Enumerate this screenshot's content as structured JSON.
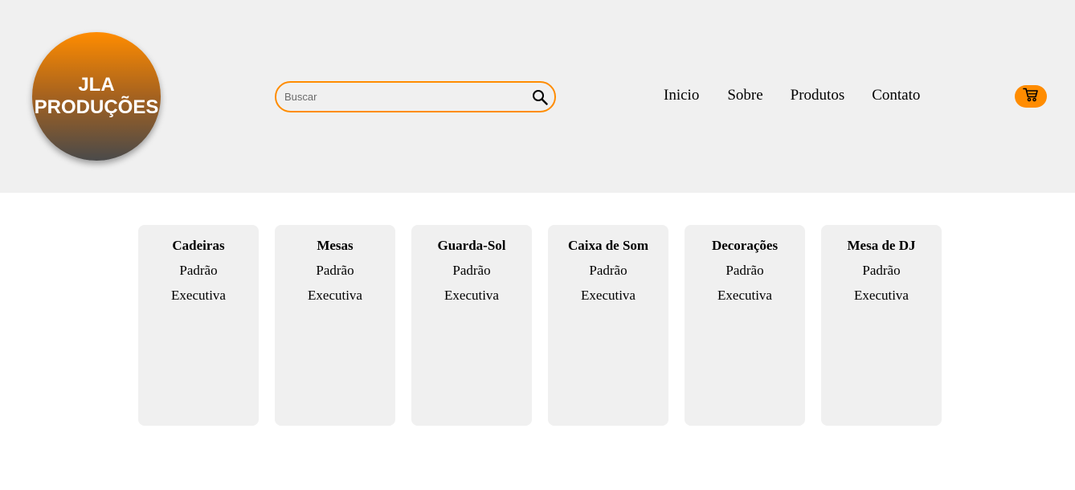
{
  "logo": {
    "line1": "JLA",
    "line2": "PRODUÇÕES"
  },
  "search": {
    "placeholder": "Buscar",
    "value": "",
    "icon": "search-icon"
  },
  "nav": {
    "items": [
      {
        "label": "Inicio"
      },
      {
        "label": "Sobre"
      },
      {
        "label": "Produtos"
      },
      {
        "label": "Contato"
      }
    ]
  },
  "cart": {
    "icon": "cart-icon",
    "color": "#ff8c00"
  },
  "colors": {
    "accent": "#ff8c00",
    "header_bg": "#f0f0f0",
    "card_bg": "#f0f0f0"
  },
  "categories": [
    {
      "title": "Cadeiras",
      "items": [
        "Padrão",
        "Executiva"
      ]
    },
    {
      "title": "Mesas",
      "items": [
        "Padrão",
        "Executiva"
      ]
    },
    {
      "title": "Guarda-Sol",
      "items": [
        "Padrão",
        "Executiva"
      ]
    },
    {
      "title": "Caixa de Som",
      "items": [
        "Padrão",
        "Executiva"
      ]
    },
    {
      "title": "Decorações",
      "items": [
        "Padrão",
        "Executiva"
      ]
    },
    {
      "title": "Mesa de DJ",
      "items": [
        "Padrão",
        "Executiva"
      ]
    }
  ]
}
